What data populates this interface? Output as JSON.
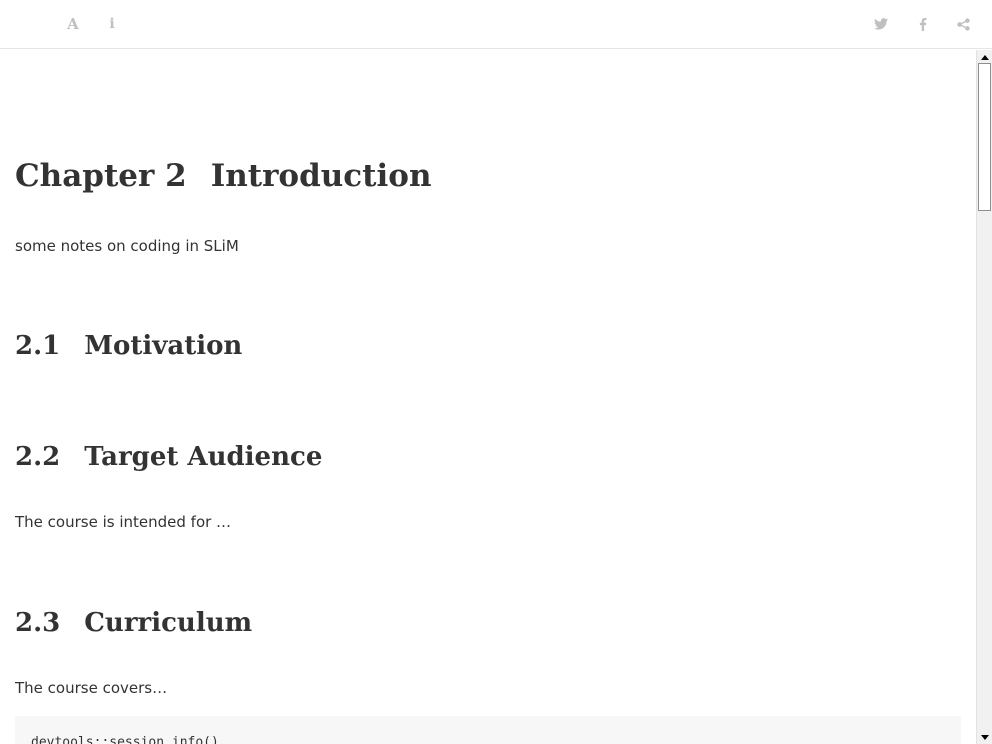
{
  "toolbar": {
    "left_buttons": [
      {
        "icon": "font-icon",
        "label": "A"
      },
      {
        "icon": "info-icon",
        "label": "i"
      }
    ],
    "right_buttons": [
      {
        "icon": "twitter-icon"
      },
      {
        "icon": "facebook-icon"
      },
      {
        "icon": "share-icon"
      }
    ],
    "icon_color": "#c0c0c0"
  },
  "chapter": {
    "number": "Chapter 2",
    "title": "Introduction",
    "intro": "some notes on coding in SLiM"
  },
  "sections": [
    {
      "number": "2.1",
      "title": "Motivation",
      "text": ""
    },
    {
      "number": "2.2",
      "title": "Target Audience",
      "text": "The course is intended for …"
    },
    {
      "number": "2.3",
      "title": "Curriculum",
      "text": "The course covers…"
    }
  ],
  "code": {
    "line1": "devtools::session_info()"
  }
}
